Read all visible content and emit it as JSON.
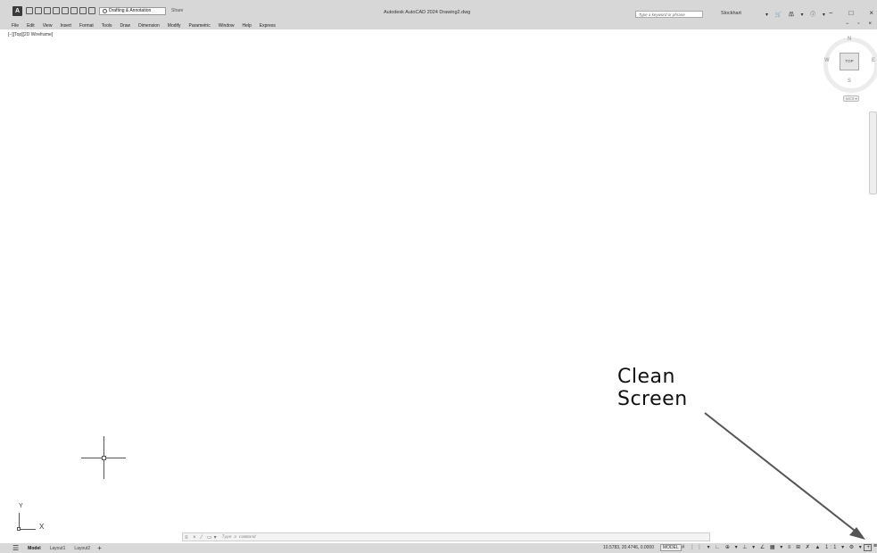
{
  "titlebar": {
    "logo": "A",
    "workspace": "Drafting & Annotation",
    "share": "Share",
    "app_title": "Autodesk AutoCAD 2024   Drawing2.dwg",
    "search_placeholder": "Type a keyword or phrase",
    "user": "Slockhart",
    "right_icons": "▾ 🛒 品 ▾ ⓘ ▾",
    "window_controls": [
      "−",
      "□",
      "×"
    ]
  },
  "menubar": {
    "items": [
      "File",
      "Edit",
      "View",
      "Insert",
      "Format",
      "Tools",
      "Draw",
      "Dimension",
      "Modify",
      "Parametric",
      "Window",
      "Help",
      "Express"
    ],
    "doc_controls": [
      "−",
      "▫",
      "×"
    ]
  },
  "viewport": {
    "label": "[−][Top][2D Wireframe]",
    "viewcube": {
      "face": "TOP",
      "north": "N",
      "south": "S",
      "east": "E",
      "west": "W",
      "wcs": "WCS ▾"
    },
    "ucs": {
      "x": "X",
      "y": "Y"
    }
  },
  "annotation": {
    "line1": "Clean",
    "line2": "Screen"
  },
  "commandline": {
    "icons": "≡ × ⁄ ▭▾",
    "placeholder": "Type a command"
  },
  "statusbar": {
    "tabs": [
      "Model",
      "Layout1",
      "Layout2"
    ],
    "add_tab": "+",
    "coordinates": "10.5783, 20.4746, 0.0000",
    "model": "MODEL",
    "icons": "#  ⋮⋮ ▾ ∟ ⊕ ▾ ⊥ ▾ ∠ ▦ ▾ ≡ ⊞ ✗ ▲ 1:1 ▾ ⚙ ▾ +",
    "customization": "≡"
  }
}
